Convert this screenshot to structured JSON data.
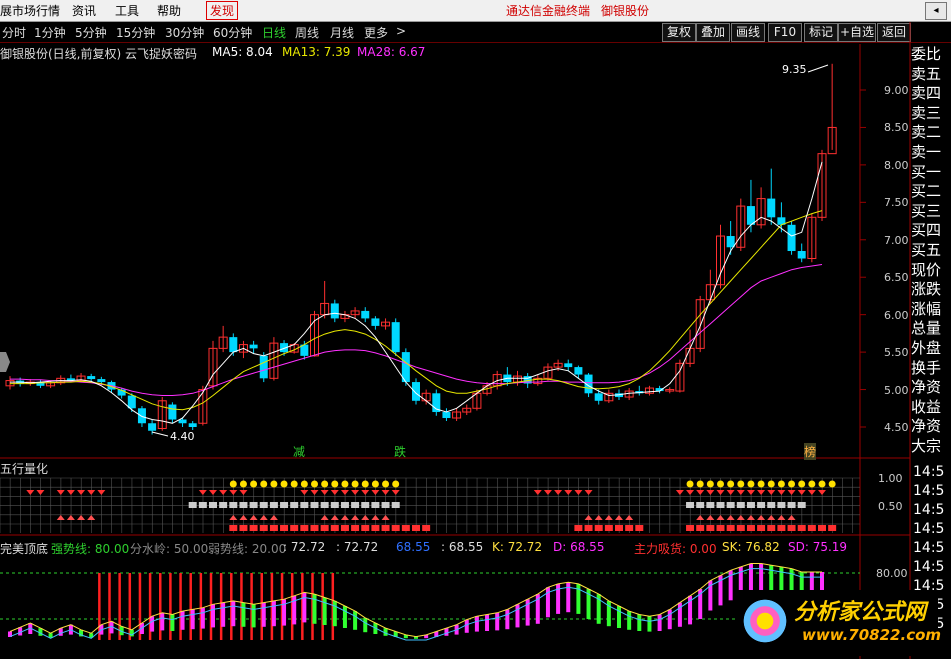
{
  "menu": {
    "items": [
      "展市场行情",
      "资讯",
      "工具",
      "帮助"
    ],
    "discover": "发现",
    "center_links": [
      "通达信金融终端",
      "御银股份"
    ]
  },
  "toolbar": {
    "periods": [
      "分时",
      "1分钟",
      "5分钟",
      "15分钟",
      "30分钟",
      "60分钟",
      "日线",
      "周线",
      "月线",
      "更多",
      ">"
    ],
    "active_period": "日线",
    "buttons": [
      "复权",
      "叠加",
      "画线",
      "F10",
      "标记",
      "+自选",
      "返回"
    ]
  },
  "main_chart": {
    "title": "御银股份(日线,前复权) 云飞捉妖密码",
    "ma5_label": "MA5: 8.04",
    "ma13_label": "MA13: 7.39",
    "ma28_label": "MA28: 6.67",
    "high_label": "9.35",
    "low_label": "4.40",
    "markers": [
      "减",
      "跌",
      "榜"
    ],
    "y_ticks": [
      "9.00",
      "8.50",
      "8.00",
      "7.50",
      "7.00",
      "6.50",
      "6.00",
      "5.50",
      "5.00",
      "4.50"
    ]
  },
  "chart_data": {
    "type": "candlestick",
    "title": "御银股份(日线,前复权) 云飞捉妖密码",
    "ylim": [
      4.2,
      9.6
    ],
    "candles": [
      {
        "o": 5.05,
        "c": 5.12,
        "h": 5.18,
        "l": 5.0
      },
      {
        "o": 5.12,
        "c": 5.08,
        "h": 5.16,
        "l": 5.04
      },
      {
        "o": 5.08,
        "c": 5.1,
        "h": 5.14,
        "l": 5.05
      },
      {
        "o": 5.1,
        "c": 5.05,
        "h": 5.13,
        "l": 5.02
      },
      {
        "o": 5.05,
        "c": 5.09,
        "h": 5.12,
        "l": 5.02
      },
      {
        "o": 5.09,
        "c": 5.15,
        "h": 5.19,
        "l": 5.06
      },
      {
        "o": 5.15,
        "c": 5.12,
        "h": 5.2,
        "l": 5.1
      },
      {
        "o": 5.12,
        "c": 5.18,
        "h": 5.22,
        "l": 5.1
      },
      {
        "o": 5.18,
        "c": 5.14,
        "h": 5.21,
        "l": 5.11
      },
      {
        "o": 5.14,
        "c": 5.1,
        "h": 5.17,
        "l": 5.06
      },
      {
        "o": 5.1,
        "c": 5.0,
        "h": 5.12,
        "l": 4.96
      },
      {
        "o": 5.0,
        "c": 4.92,
        "h": 5.02,
        "l": 4.88
      },
      {
        "o": 4.92,
        "c": 4.75,
        "h": 4.95,
        "l": 4.7
      },
      {
        "o": 4.75,
        "c": 4.55,
        "h": 4.78,
        "l": 4.5
      },
      {
        "o": 4.55,
        "c": 4.45,
        "h": 4.6,
        "l": 4.4
      },
      {
        "o": 4.48,
        "c": 4.85,
        "h": 4.9,
        "l": 4.45
      },
      {
        "o": 4.8,
        "c": 4.6,
        "h": 4.83,
        "l": 4.55
      },
      {
        "o": 4.6,
        "c": 4.55,
        "h": 4.63,
        "l": 4.5
      },
      {
        "o": 4.55,
        "c": 4.5,
        "h": 4.58,
        "l": 4.46
      },
      {
        "o": 4.55,
        "c": 5.0,
        "h": 5.05,
        "l": 4.52
      },
      {
        "o": 5.05,
        "c": 5.55,
        "h": 5.65,
        "l": 5.0
      },
      {
        "o": 5.55,
        "c": 5.7,
        "h": 5.85,
        "l": 5.5
      },
      {
        "o": 5.7,
        "c": 5.5,
        "h": 5.75,
        "l": 5.45
      },
      {
        "o": 5.5,
        "c": 5.6,
        "h": 5.65,
        "l": 5.42
      },
      {
        "o": 5.6,
        "c": 5.55,
        "h": 5.65,
        "l": 5.48
      },
      {
        "o": 5.45,
        "c": 5.15,
        "h": 5.5,
        "l": 5.1
      },
      {
        "o": 5.15,
        "c": 5.62,
        "h": 5.7,
        "l": 5.12
      },
      {
        "o": 5.62,
        "c": 5.5,
        "h": 5.66,
        "l": 5.45
      },
      {
        "o": 5.5,
        "c": 5.6,
        "h": 5.62,
        "l": 5.48
      },
      {
        "o": 5.6,
        "c": 5.45,
        "h": 5.65,
        "l": 5.4
      },
      {
        "o": 5.45,
        "c": 6.0,
        "h": 6.05,
        "l": 5.44
      },
      {
        "o": 6.0,
        "c": 6.15,
        "h": 6.45,
        "l": 5.95
      },
      {
        "o": 6.15,
        "c": 5.95,
        "h": 6.2,
        "l": 5.9
      },
      {
        "o": 5.95,
        "c": 6.0,
        "h": 6.05,
        "l": 5.9
      },
      {
        "o": 6.0,
        "c": 6.05,
        "h": 6.1,
        "l": 5.95
      },
      {
        "o": 6.05,
        "c": 5.95,
        "h": 6.1,
        "l": 5.9
      },
      {
        "o": 5.95,
        "c": 5.85,
        "h": 5.98,
        "l": 5.8
      },
      {
        "o": 5.85,
        "c": 5.9,
        "h": 5.95,
        "l": 5.8
      },
      {
        "o": 5.9,
        "c": 5.5,
        "h": 5.95,
        "l": 5.45
      },
      {
        "o": 5.5,
        "c": 5.1,
        "h": 5.55,
        "l": 5.05
      },
      {
        "o": 5.1,
        "c": 4.85,
        "h": 5.15,
        "l": 4.8
      },
      {
        "o": 4.85,
        "c": 4.95,
        "h": 5.0,
        "l": 4.8
      },
      {
        "o": 4.95,
        "c": 4.7,
        "h": 5.0,
        "l": 4.65
      },
      {
        "o": 4.7,
        "c": 4.62,
        "h": 4.75,
        "l": 4.58
      },
      {
        "o": 4.62,
        "c": 4.7,
        "h": 4.75,
        "l": 4.58
      },
      {
        "o": 4.7,
        "c": 4.75,
        "h": 4.8,
        "l": 4.66
      },
      {
        "o": 4.75,
        "c": 4.95,
        "h": 5.0,
        "l": 4.72
      },
      {
        "o": 4.95,
        "c": 5.05,
        "h": 5.1,
        "l": 4.92
      },
      {
        "o": 5.05,
        "c": 5.2,
        "h": 5.25,
        "l": 5.0
      },
      {
        "o": 5.2,
        "c": 5.1,
        "h": 5.3,
        "l": 5.05
      },
      {
        "o": 5.1,
        "c": 5.18,
        "h": 5.25,
        "l": 5.05
      },
      {
        "o": 5.18,
        "c": 5.08,
        "h": 5.22,
        "l": 5.02
      },
      {
        "o": 5.08,
        "c": 5.15,
        "h": 5.2,
        "l": 5.05
      },
      {
        "o": 5.15,
        "c": 5.3,
        "h": 5.35,
        "l": 5.12
      },
      {
        "o": 5.3,
        "c": 5.35,
        "h": 5.4,
        "l": 5.25
      },
      {
        "o": 5.35,
        "c": 5.3,
        "h": 5.4,
        "l": 5.25
      },
      {
        "o": 5.3,
        "c": 5.2,
        "h": 5.32,
        "l": 5.15
      },
      {
        "o": 5.2,
        "c": 4.95,
        "h": 5.22,
        "l": 4.9
      },
      {
        "o": 4.95,
        "c": 4.85,
        "h": 5.0,
        "l": 4.8
      },
      {
        "o": 4.85,
        "c": 4.95,
        "h": 5.0,
        "l": 4.82
      },
      {
        "o": 4.95,
        "c": 4.9,
        "h": 5.0,
        "l": 4.86
      },
      {
        "o": 4.9,
        "c": 4.98,
        "h": 5.02,
        "l": 4.86
      },
      {
        "o": 4.98,
        "c": 4.95,
        "h": 5.05,
        "l": 4.92
      },
      {
        "o": 4.95,
        "c": 5.02,
        "h": 5.05,
        "l": 4.92
      },
      {
        "o": 5.02,
        "c": 4.98,
        "h": 5.05,
        "l": 4.95
      },
      {
        "o": 4.98,
        "c": 5.0,
        "h": 5.03,
        "l": 4.95
      },
      {
        "o": 4.98,
        "c": 5.35,
        "h": 5.4,
        "l": 4.96
      },
      {
        "o": 5.35,
        "c": 5.55,
        "h": 5.8,
        "l": 5.3
      },
      {
        "o": 5.55,
        "c": 6.2,
        "h": 6.25,
        "l": 5.5
      },
      {
        "o": 6.2,
        "c": 6.4,
        "h": 6.6,
        "l": 6.15
      },
      {
        "o": 6.4,
        "c": 7.05,
        "h": 7.2,
        "l": 6.35
      },
      {
        "o": 7.05,
        "c": 6.9,
        "h": 7.25,
        "l": 6.8
      },
      {
        "o": 6.9,
        "c": 7.45,
        "h": 7.55,
        "l": 6.85
      },
      {
        "o": 7.45,
        "c": 7.2,
        "h": 7.8,
        "l": 7.1
      },
      {
        "o": 7.2,
        "c": 7.55,
        "h": 7.7,
        "l": 7.15
      },
      {
        "o": 7.55,
        "c": 7.3,
        "h": 7.95,
        "l": 7.2
      },
      {
        "o": 7.3,
        "c": 7.2,
        "h": 7.5,
        "l": 7.1
      },
      {
        "o": 7.2,
        "c": 6.85,
        "h": 7.25,
        "l": 6.8
      },
      {
        "o": 6.85,
        "c": 6.75,
        "h": 6.95,
        "l": 6.7
      },
      {
        "o": 6.75,
        "c": 7.3,
        "h": 7.35,
        "l": 6.7
      },
      {
        "o": 7.3,
        "c": 8.15,
        "h": 8.2,
        "l": 7.25
      },
      {
        "o": 8.15,
        "c": 8.5,
        "h": 9.35,
        "l": 8.2
      }
    ],
    "ma5": [
      5.1,
      5.1,
      5.09,
      5.1,
      5.11,
      5.12,
      5.12,
      5.13,
      5.11,
      5.05,
      4.96,
      4.85,
      4.73,
      4.64,
      4.6,
      4.58,
      4.55,
      4.62,
      4.78,
      4.96,
      5.2,
      5.35,
      5.5,
      5.55,
      5.48,
      5.45,
      5.5,
      5.55,
      5.6,
      5.75,
      5.92,
      6.0,
      6.02,
      6.0,
      5.95,
      5.85,
      5.7,
      5.5,
      5.3,
      5.1,
      4.95,
      4.85,
      4.74,
      4.7,
      4.75,
      4.85,
      4.95,
      5.05,
      5.12,
      5.15,
      5.15,
      5.15,
      5.2,
      5.25,
      5.28,
      5.25,
      5.15,
      5.05,
      4.98,
      4.92,
      4.93,
      4.95,
      4.96,
      4.97,
      4.98,
      5.08,
      5.25,
      5.55,
      5.85,
      6.2,
      6.55,
      6.85,
      7.05,
      7.2,
      7.3,
      7.25,
      7.15,
      7.05,
      7.1,
      7.55,
      8.04
    ],
    "ma13": [
      5.08,
      5.08,
      5.08,
      5.09,
      5.09,
      5.1,
      5.1,
      5.11,
      5.1,
      5.08,
      5.04,
      4.99,
      4.93,
      4.87,
      4.81,
      4.77,
      4.74,
      4.73,
      4.76,
      4.82,
      4.92,
      5.03,
      5.14,
      5.24,
      5.3,
      5.36,
      5.42,
      5.48,
      5.53,
      5.6,
      5.68,
      5.74,
      5.78,
      5.8,
      5.78,
      5.74,
      5.67,
      5.58,
      5.47,
      5.36,
      5.25,
      5.15,
      5.05,
      4.98,
      4.95,
      4.95,
      4.98,
      5.01,
      5.05,
      5.08,
      5.1,
      5.12,
      5.14,
      5.14,
      5.12,
      5.08,
      5.04,
      5.02,
      5.01,
      5.02,
      5.04,
      5.08,
      5.15,
      5.25,
      5.38,
      5.52,
      5.68,
      5.84,
      6.0,
      6.15,
      6.3,
      6.45,
      6.6,
      6.75,
      6.9,
      7.05,
      7.2,
      7.25,
      7.3,
      7.35,
      7.39
    ],
    "ma28": [
      5.14,
      5.14,
      5.13,
      5.13,
      5.12,
      5.12,
      5.11,
      5.1,
      5.09,
      5.07,
      5.05,
      5.02,
      4.98,
      4.95,
      4.93,
      4.92,
      4.92,
      4.93,
      4.95,
      4.99,
      5.04,
      5.09,
      5.14,
      5.18,
      5.22,
      5.26,
      5.3,
      5.34,
      5.38,
      5.42,
      5.46,
      5.5,
      5.52,
      5.53,
      5.53,
      5.52,
      5.49,
      5.45,
      5.4,
      5.35,
      5.3,
      5.26,
      5.22,
      5.18,
      5.14,
      5.11,
      5.09,
      5.08,
      5.08,
      5.08,
      5.09,
      5.1,
      5.1,
      5.11,
      5.11,
      5.1,
      5.1,
      5.09,
      5.09,
      5.09,
      5.1,
      5.12,
      5.16,
      5.22,
      5.3,
      5.4,
      5.52,
      5.64,
      5.76,
      5.88,
      6.0,
      6.12,
      6.24,
      6.36,
      6.45,
      6.5,
      6.55,
      6.6,
      6.63,
      6.65,
      6.67
    ]
  },
  "sidebar": [
    "委比",
    "卖五",
    "卖四",
    "卖三",
    "卖二",
    "卖一",
    "买一",
    "买二",
    "买三",
    "买四",
    "买五",
    "现价",
    "涨跌",
    "涨幅",
    "总量",
    "外盘",
    "换手",
    "净资",
    "收益",
    "净资",
    "大宗"
  ],
  "panel2": {
    "title": "五行量化",
    "y_ticks": [
      "1.00",
      "0.50"
    ],
    "right_values": [
      "14:5",
      "14:5",
      "14:5",
      "14:5"
    ]
  },
  "panel3": {
    "title": "完美顶底",
    "strong_label": "强势线: 80.00",
    "divide_label": "分水岭: 50.00",
    "weak_label": "弱势线: 20.00",
    "v1": ": 72.72",
    "v2": ": 72.72",
    "v3": "68.55",
    "v4": ": 68.55",
    "k_label": "K: 72.72",
    "d_label": "D: 68.55",
    "main_label": "主力吸货: 0.00",
    "sk_label": "SK: 76.82",
    "sd_label": "SD: 75.19",
    "y_tick": "80.00",
    "right_values": [
      "14:5",
      "14:5",
      "14:5",
      "14:5",
      "14:5"
    ]
  },
  "watermark": {
    "text": "分析家公式网",
    "url": "www.70822.com"
  },
  "colors": {
    "up": "#ff3030",
    "down": "#00d8ff",
    "ma5": "#ffffff",
    "ma13": "#e8e800",
    "ma28": "#ff30ff"
  }
}
